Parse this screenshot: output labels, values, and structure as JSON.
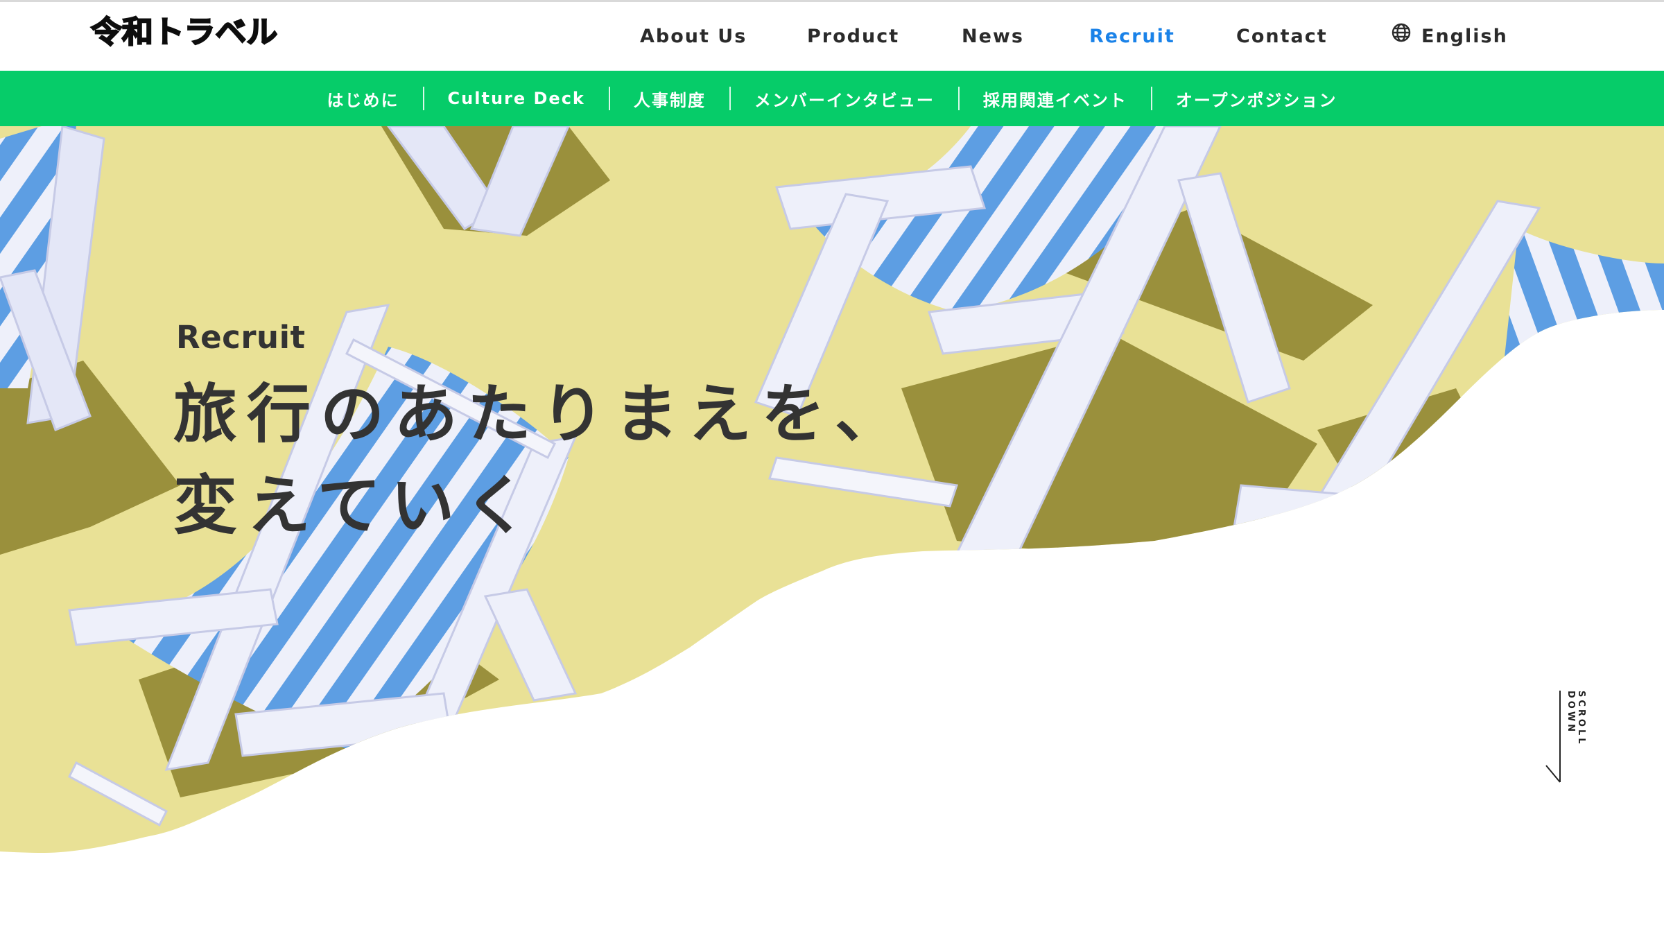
{
  "header": {
    "logo_text": "令和トラベル",
    "nav": [
      {
        "label": "About Us",
        "active": false
      },
      {
        "label": "Product",
        "active": false
      },
      {
        "label": "News",
        "active": false
      },
      {
        "label": "Recruit",
        "active": true
      },
      {
        "label": "Contact",
        "active": false
      }
    ],
    "language": {
      "icon": "globe-icon",
      "label": "English"
    },
    "active_color": "#1a82e8"
  },
  "subnav": {
    "background": "#06cc69",
    "items": [
      {
        "label": "はじめに"
      },
      {
        "label": "Culture Deck"
      },
      {
        "label": "人事制度"
      },
      {
        "label": "メンバーインタビュー"
      },
      {
        "label": "採用関連イベント"
      },
      {
        "label": "オープンポジション"
      }
    ]
  },
  "hero": {
    "eyebrow": "Recruit",
    "title_lines": [
      "旅行のあたりまえを、",
      "変えていく"
    ],
    "image_description": "striped blue-and-white deck chairs on a yellow background",
    "background_color": "#e9e196"
  },
  "scroll_indicator": {
    "label": "SCROLL DOWN",
    "icon": "arrow-down-icon"
  }
}
